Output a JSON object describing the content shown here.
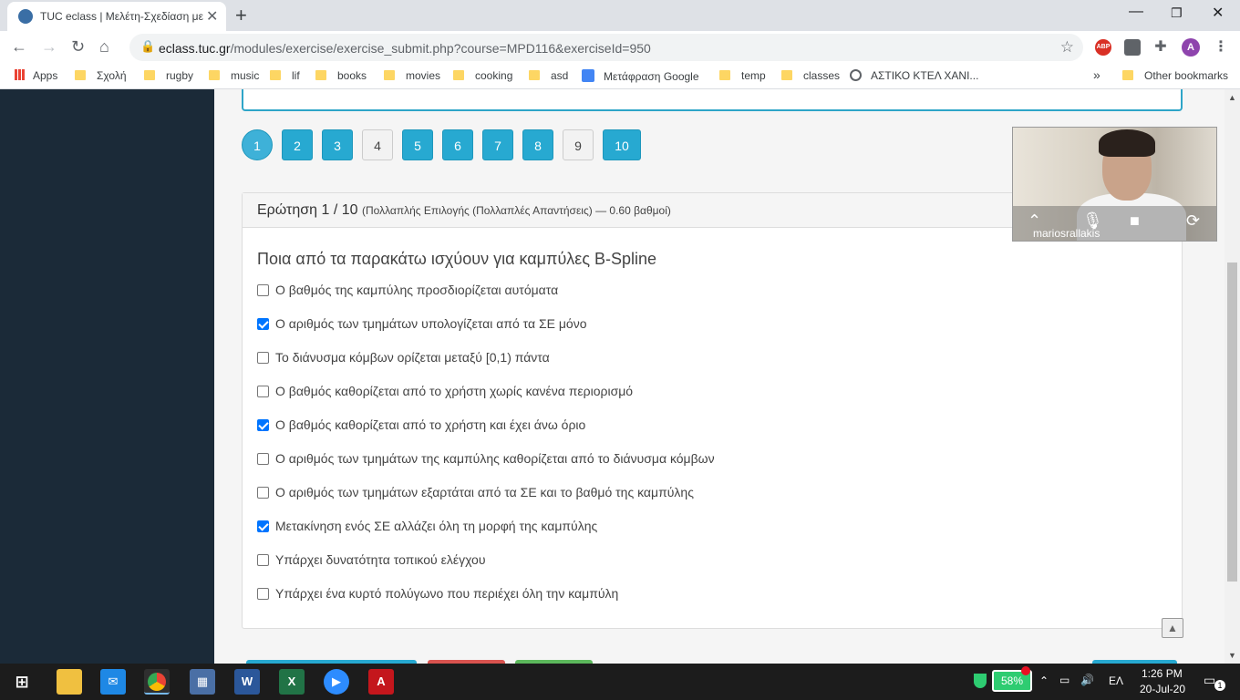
{
  "browser": {
    "tab_title": "TUC eclass | Μελέτη-Σχεδίαση με",
    "tab_close": "✕",
    "new_tab": "+",
    "url_host": "eclass.tuc.gr",
    "url_path": "/modules/exercise/exercise_submit.php?course=MPD116&exerciseId=950",
    "profile_initial": "A",
    "abp_label": "ABP",
    "bookmarks": [
      "Apps",
      "Σχολή",
      "rugby",
      "music",
      "lif",
      "books",
      "movies",
      "cooking",
      "asd",
      "Μετάφραση Google",
      "temp",
      "classes",
      "ΑΣΤΙΚΟ ΚΤΕΛ ΧΑΝΙ...",
      "»",
      "Other bookmarks"
    ]
  },
  "pagination": [
    "1",
    "2",
    "3",
    "4",
    "5",
    "6",
    "7",
    "8",
    "9",
    "10"
  ],
  "question": {
    "number": "Ερώτηση 1 / 10",
    "meta": "(Πολλαπλής Επιλογής (Πολλαπλές Απαντήσεις) — 0.60 βαθμοί)",
    "text": "Ποια από τα παρακάτω ισχύουν για καμπύλες B-Spline",
    "options": [
      {
        "label": "Ο βαθμός της καμπύλης προσδιορίζεται αυτόματα",
        "checked": false
      },
      {
        "label": "Ο αριθμός των τμημάτων υπολογίζεται από τα ΣΕ μόνο",
        "checked": true
      },
      {
        "label": "Το διάνυσμα κόμβων ορίζεται μεταξύ [0,1) πάντα",
        "checked": false
      },
      {
        "label": "Ο βαθμός καθορίζεται από το χρήστη χωρίς κανένα περιορισμό",
        "checked": false
      },
      {
        "label": "Ο βαθμός καθορίζεται από το χρήστη και έχει άνω όριο",
        "checked": true
      },
      {
        "label": "Ο αριθμός των τμημάτων της καμπύλης καθορίζεται από το διάνυσμα κόμβων",
        "checked": false
      },
      {
        "label": "Ο αριθμός των τμημάτων εξαρτάται από τα ΣΕ και το βαθμό της καμπύλης",
        "checked": false
      },
      {
        "label": "Μετακίνηση ενός ΣΕ αλλάζει όλη τη μορφή της καμπύλης",
        "checked": true
      },
      {
        "label": "Υπάρχει δυνατότητα τοπικού ελέγχου",
        "checked": false
      },
      {
        "label": "Υπάρχει ένα κυρτό πολύγωνο που περιέχει όλη την καμπύλη",
        "checked": false
      }
    ]
  },
  "video": {
    "participant": "mariosrallakis"
  },
  "taskbar": {
    "battery": "58%",
    "language": "ΕΛ",
    "time": "1:26 PM",
    "date": "20-Jul-20",
    "notifications": "1"
  },
  "colors": {
    "accent": "#27a9d1",
    "sidebar": "#1b2a38",
    "checkbox": "#0075ff"
  }
}
